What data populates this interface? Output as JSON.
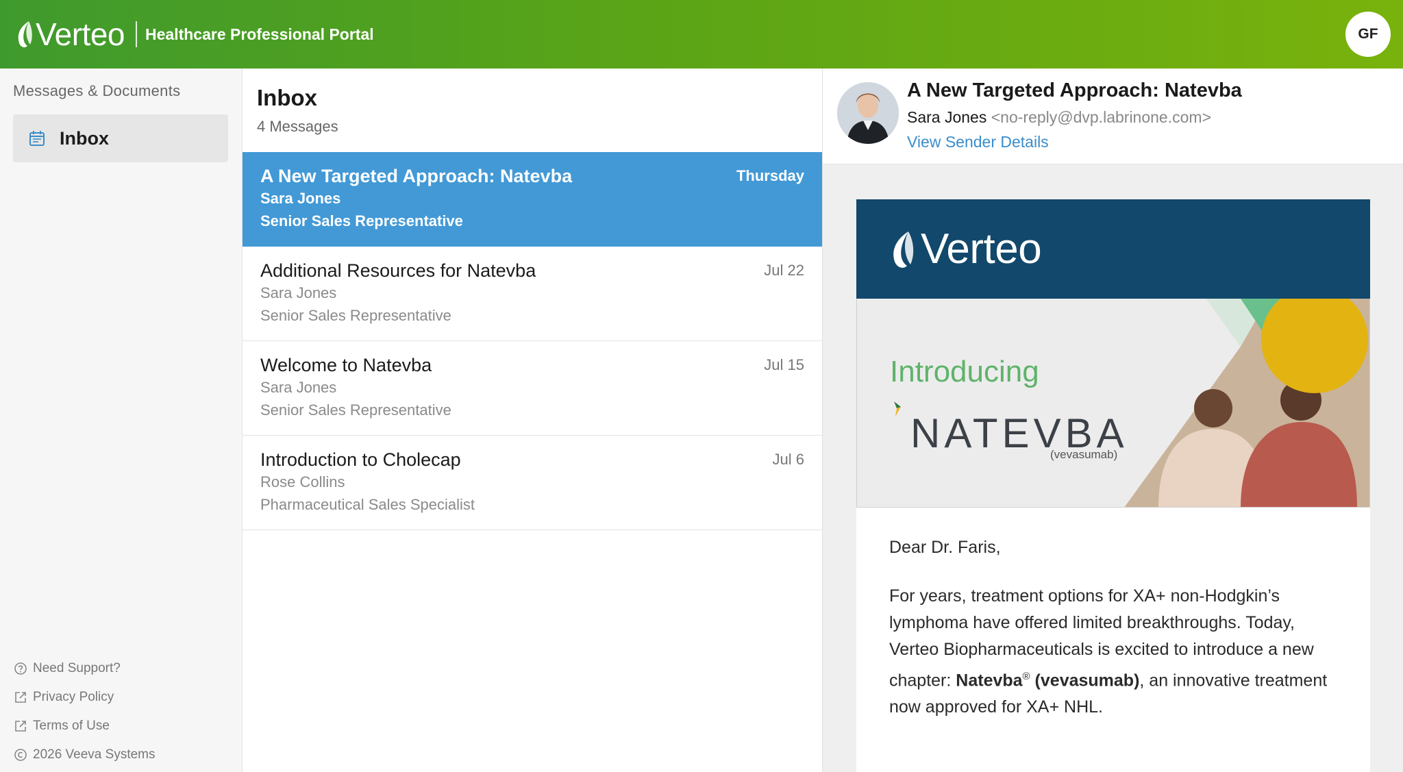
{
  "header": {
    "brand": "Verteo",
    "portal_title": "Healthcare Professional Portal",
    "user_initials": "GF",
    "colors": {
      "gradient_start": "#3f9a2d",
      "gradient_end": "#79b20c"
    }
  },
  "sidebar": {
    "heading": "Messages & Documents",
    "items": [
      {
        "label": "Inbox",
        "icon": "calendar-icon",
        "selected": true
      }
    ],
    "links": [
      {
        "label": "Need Support?",
        "icon": "help-circle-icon"
      },
      {
        "label": "Privacy Policy",
        "icon": "external-link-icon"
      },
      {
        "label": "Terms of Use",
        "icon": "external-link-icon"
      },
      {
        "label": "2026 Veeva Systems",
        "icon": "copyright-icon"
      }
    ]
  },
  "inbox": {
    "title": "Inbox",
    "count_label": "4 Messages",
    "messages": [
      {
        "subject": "A New Targeted Approach: Natevba",
        "sender": "Sara Jones",
        "role": "Senior Sales Representative",
        "date": "Thursday",
        "selected": true
      },
      {
        "subject": "Additional Resources for Natevba",
        "sender": "Sara Jones",
        "role": "Senior Sales Representative",
        "date": "Jul 22"
      },
      {
        "subject": "Welcome to Natevba",
        "sender": "Sara Jones",
        "role": "Senior Sales Representative",
        "date": "Jul 15"
      },
      {
        "subject": "Introduction to Cholecap",
        "sender": "Rose Collins",
        "role": "Pharmaceutical Sales Specialist",
        "date": "Jul 6"
      }
    ],
    "accent": "#4299d6"
  },
  "reader": {
    "subject": "A New Targeted Approach: Natevba",
    "sender_name": "Sara Jones",
    "sender_email": "<no-reply@dvp.labrinone.com>",
    "view_sender_label": "View Sender Details",
    "email": {
      "banner_brand": "Verteo",
      "hero_intro": "Introducing",
      "hero_brand": "NATEVBA",
      "hero_generic": "(vevasumab)",
      "greeting": "Dear Dr. Faris,",
      "para_1": "For years, treatment options for XA+ non-Hodgkin’s lymphoma have offered limited breakthroughs. Today, Verteo Biopharmaceuticals is excited to introduce a new chapter: ",
      "para_bold": "Natevba",
      "para_reg": "®",
      "para_bold2": " (vevasumab)",
      "para_2": ", an innovative treatment now approved for XA+ NHL.",
      "banner_color": "#12486b"
    }
  }
}
